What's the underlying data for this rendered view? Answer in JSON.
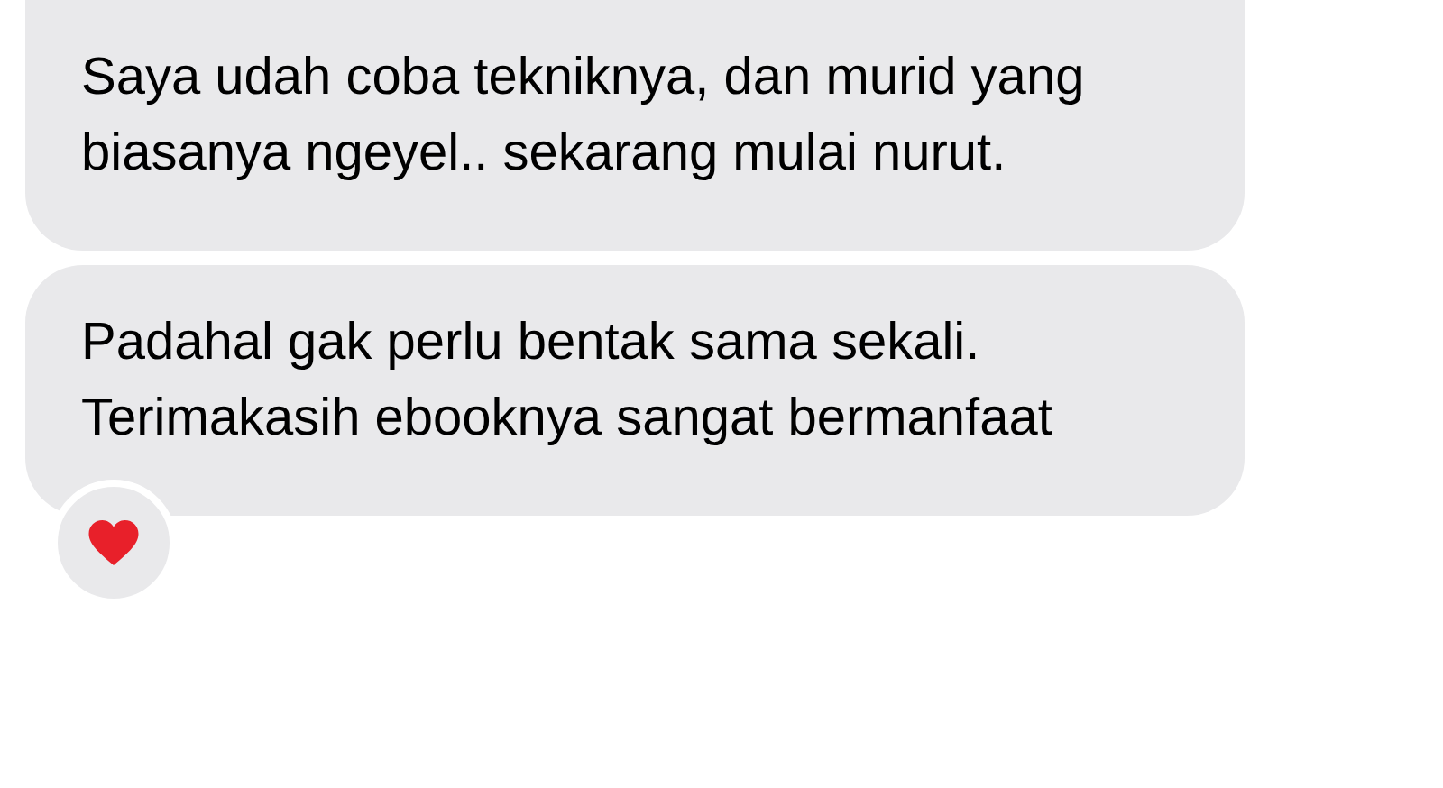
{
  "messages": [
    {
      "text": "Saya udah coba tekniknya, dan murid yang biasanya ngeyel.. sekarang mulai nurut.",
      "reaction": false
    },
    {
      "text": "Padahal gak perlu bentak sama sekali. Terimakasih ebooknya sangat bermanfaat",
      "reaction": true
    }
  ]
}
